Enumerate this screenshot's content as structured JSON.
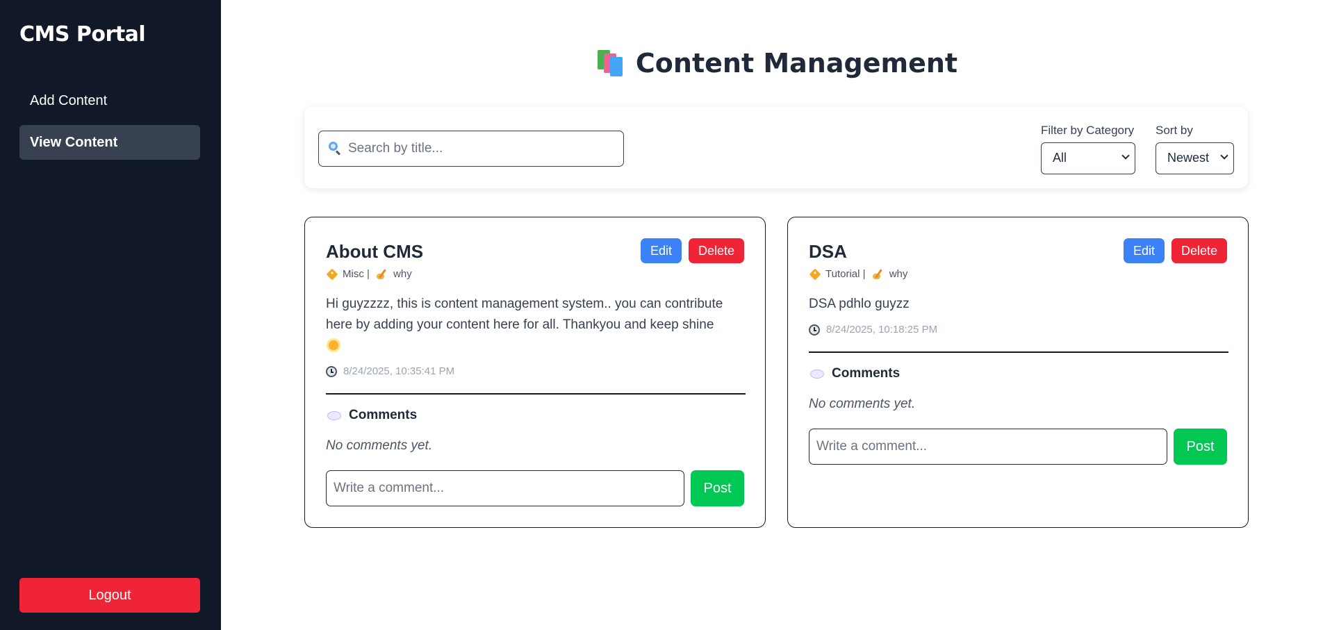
{
  "sidebar": {
    "brand": "CMS Portal",
    "items": [
      {
        "label": "Add Content",
        "active": false
      },
      {
        "label": "View Content",
        "active": true
      }
    ],
    "logout_label": "Logout"
  },
  "main": {
    "title": "Content Management",
    "title_icon": "books-icon",
    "search": {
      "placeholder": "Search by title...",
      "value": "",
      "icon": "search-icon"
    },
    "filter": {
      "label": "Filter by Category",
      "selected": "All"
    },
    "sort": {
      "label": "Sort by",
      "selected": "Newest"
    }
  },
  "posts": [
    {
      "title": "About CMS",
      "edit_label": "Edit",
      "delete_label": "Delete",
      "category": "Misc | ",
      "author": "why",
      "body": "Hi guyzzzz, this is content management system.. you can contribute here by adding your content here for all. Thankyou and keep shine",
      "timestamp": "8/24/2025, 10:35:41 PM",
      "comments_heading": "Comments",
      "no_comments": "No comments yet.",
      "comment_placeholder": "Write a comment...",
      "post_label": "Post"
    },
    {
      "title": "DSA",
      "edit_label": "Edit",
      "delete_label": "Delete",
      "category": "Tutorial | ",
      "author": "why",
      "body": "DSA pdhlo guyzz",
      "timestamp": "8/24/2025, 10:18:25 PM",
      "comments_heading": "Comments",
      "no_comments": "No comments yet.",
      "comment_placeholder": "Write a comment...",
      "post_label": "Post"
    }
  ],
  "colors": {
    "sidebar_bg": "#111827",
    "active_nav_bg": "#374151",
    "edit_blue": "#3b82f6",
    "delete_red": "#ef2436",
    "post_green": "#00c853"
  }
}
